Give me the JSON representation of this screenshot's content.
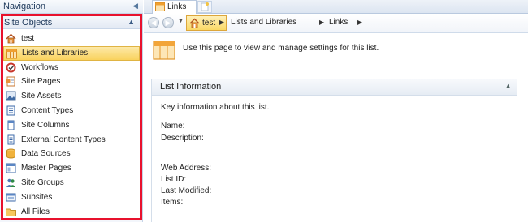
{
  "nav": {
    "title": "Navigation",
    "site_objects_title": "Site Objects",
    "items": [
      {
        "label": "test",
        "icon": "home-icon"
      },
      {
        "label": "Lists and Libraries",
        "icon": "list-icon",
        "selected": true
      },
      {
        "label": "Workflows",
        "icon": "workflow-icon"
      },
      {
        "label": "Site Pages",
        "icon": "site-pages-icon"
      },
      {
        "label": "Site Assets",
        "icon": "site-assets-icon"
      },
      {
        "label": "Content Types",
        "icon": "content-types-icon"
      },
      {
        "label": "Site Columns",
        "icon": "site-columns-icon"
      },
      {
        "label": "External Content Types",
        "icon": "external-content-types-icon"
      },
      {
        "label": "Data Sources",
        "icon": "data-sources-icon"
      },
      {
        "label": "Master Pages",
        "icon": "master-pages-icon"
      },
      {
        "label": "Site Groups",
        "icon": "site-groups-icon"
      },
      {
        "label": "Subsites",
        "icon": "subsites-icon"
      },
      {
        "label": "All Files",
        "icon": "folder-icon"
      }
    ]
  },
  "tab": {
    "label": "Links"
  },
  "breadcrumb": {
    "home": "test",
    "level1": "Lists and Libraries",
    "level2": "Links"
  },
  "main": {
    "intro": "Use this page to view and manage settings for this list.",
    "panel_title": "List Information",
    "panel_subtitle": "Key information about this list.",
    "labels": {
      "name": "Name:",
      "description": "Description:",
      "web_address": "Web Address:",
      "list_id": "List ID:",
      "last_modified": "Last Modified:",
      "items": "Items:"
    }
  },
  "colors": {
    "highlight_border": "#e8112d",
    "selected_bg": "#f9d25d",
    "accent_orange": "#f0a030"
  }
}
